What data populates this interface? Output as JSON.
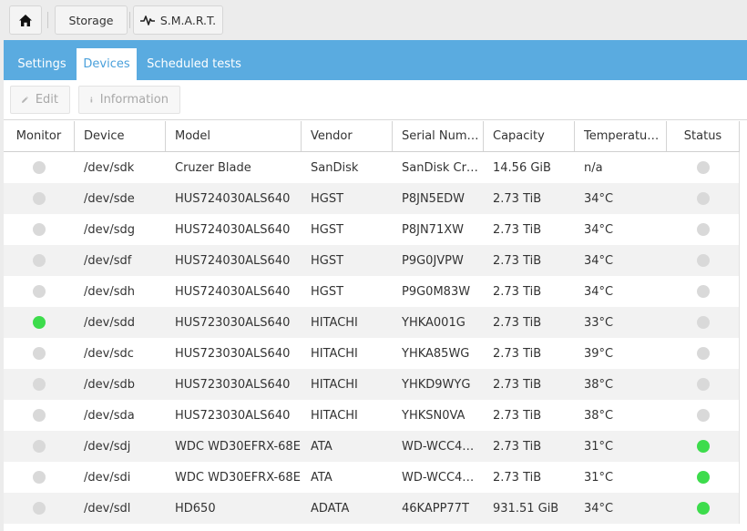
{
  "breadcrumb": {
    "home_icon": "home-icon",
    "storage": "Storage",
    "smart": "S.M.A.R.T.",
    "smart_icon": "pulse-icon"
  },
  "tabs": [
    {
      "label": "Settings",
      "active": false
    },
    {
      "label": "Devices",
      "active": true
    },
    {
      "label": "Scheduled tests",
      "active": false
    }
  ],
  "toolbar": {
    "edit_label": "Edit",
    "info_label": "Information"
  },
  "table": {
    "columns": [
      "Monitor",
      "Device",
      "Model",
      "Vendor",
      "Serial Num…",
      "Capacity",
      "Temperatu…",
      "Status"
    ],
    "rows": [
      {
        "monitor": false,
        "device": "/dev/sdk",
        "model": "Cruzer Blade",
        "vendor": "SanDisk",
        "serial": "SanDisk Cr…",
        "capacity": "14.56 GiB",
        "temperature": "n/a",
        "status": false
      },
      {
        "monitor": false,
        "device": "/dev/sde",
        "model": "HUS724030ALS640",
        "vendor": "HGST",
        "serial": "P8JN5EDW",
        "capacity": "2.73 TiB",
        "temperature": "34°C",
        "status": false
      },
      {
        "monitor": false,
        "device": "/dev/sdg",
        "model": "HUS724030ALS640",
        "vendor": "HGST",
        "serial": "P8JN71XW",
        "capacity": "2.73 TiB",
        "temperature": "34°C",
        "status": false
      },
      {
        "monitor": false,
        "device": "/dev/sdf",
        "model": "HUS724030ALS640",
        "vendor": "HGST",
        "serial": "P9G0JVPW",
        "capacity": "2.73 TiB",
        "temperature": "34°C",
        "status": false
      },
      {
        "monitor": false,
        "device": "/dev/sdh",
        "model": "HUS724030ALS640",
        "vendor": "HGST",
        "serial": "P9G0M83W",
        "capacity": "2.73 TiB",
        "temperature": "34°C",
        "status": false
      },
      {
        "monitor": true,
        "device": "/dev/sdd",
        "model": "HUS723030ALS640",
        "vendor": "HITACHI",
        "serial": "YHKA001G",
        "capacity": "2.73 TiB",
        "temperature": "33°C",
        "status": false
      },
      {
        "monitor": false,
        "device": "/dev/sdc",
        "model": "HUS723030ALS640",
        "vendor": "HITACHI",
        "serial": "YHKA85WG",
        "capacity": "2.73 TiB",
        "temperature": "39°C",
        "status": false
      },
      {
        "monitor": false,
        "device": "/dev/sdb",
        "model": "HUS723030ALS640",
        "vendor": "HITACHI",
        "serial": "YHKD9WYG",
        "capacity": "2.73 TiB",
        "temperature": "38°C",
        "status": false
      },
      {
        "monitor": false,
        "device": "/dev/sda",
        "model": "HUS723030ALS640",
        "vendor": "HITACHI",
        "serial": "YHKSN0VA",
        "capacity": "2.73 TiB",
        "temperature": "38°C",
        "status": false
      },
      {
        "monitor": false,
        "device": "/dev/sdj",
        "model": "WDC WD30EFRX-68E",
        "vendor": "ATA",
        "serial": "WD-WCC4…",
        "capacity": "2.73 TiB",
        "temperature": "31°C",
        "status": true
      },
      {
        "monitor": false,
        "device": "/dev/sdi",
        "model": "WDC WD30EFRX-68E",
        "vendor": "ATA",
        "serial": "WD-WCC4…",
        "capacity": "2.73 TiB",
        "temperature": "31°C",
        "status": true
      },
      {
        "monitor": false,
        "device": "/dev/sdl",
        "model": "HD650",
        "vendor": "ADATA",
        "serial": "46KAPP77T",
        "capacity": "931.51 GiB",
        "temperature": "34°C",
        "status": true
      }
    ]
  },
  "colors": {
    "accent": "#5aabe0",
    "active_tab_text": "#4aa0db",
    "status_on": "#3ddc4c",
    "status_off": "#d9d9d9"
  }
}
